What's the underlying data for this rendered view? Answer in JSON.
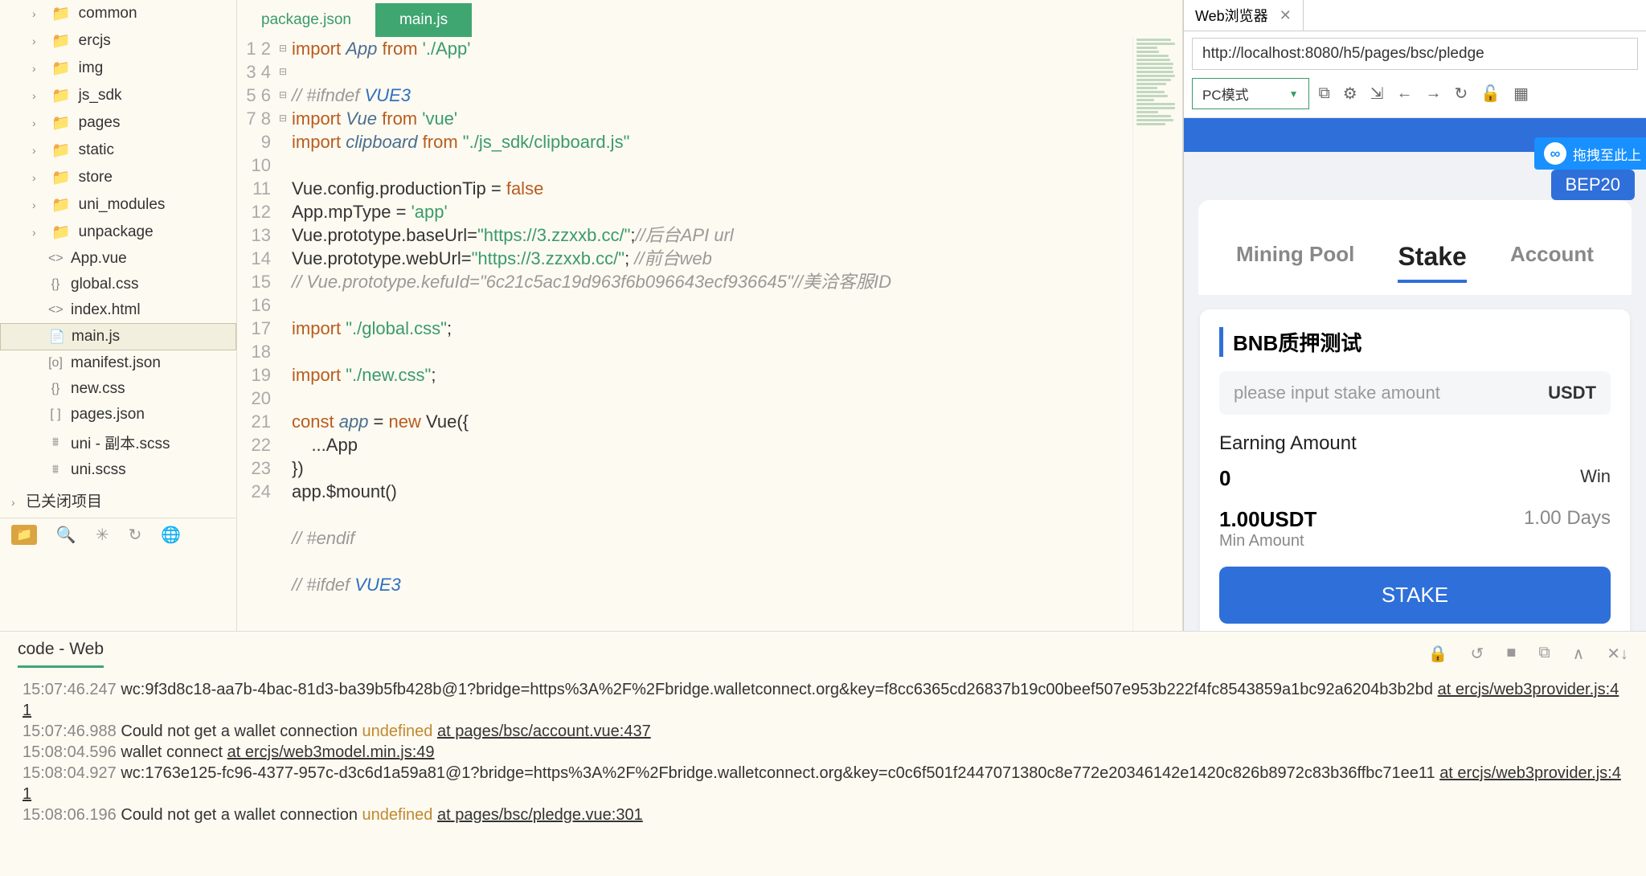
{
  "file_tree": {
    "folders": [
      {
        "name": "common"
      },
      {
        "name": "ercjs"
      },
      {
        "name": "img"
      },
      {
        "name": "js_sdk"
      },
      {
        "name": "pages"
      },
      {
        "name": "static"
      },
      {
        "name": "store"
      },
      {
        "name": "uni_modules"
      },
      {
        "name": "unpackage"
      }
    ],
    "files": [
      {
        "name": "App.vue",
        "icon": "<>",
        "sel": false
      },
      {
        "name": "global.css",
        "icon": "{}",
        "sel": false
      },
      {
        "name": "index.html",
        "icon": "<>",
        "sel": false
      },
      {
        "name": "main.js",
        "icon": "📄",
        "sel": true
      },
      {
        "name": "manifest.json",
        "icon": "[o]",
        "sel": false
      },
      {
        "name": "new.css",
        "icon": "{}",
        "sel": false
      },
      {
        "name": "pages.json",
        "icon": "[ ]",
        "sel": false
      },
      {
        "name": "uni - 副本.scss",
        "icon": "⩩",
        "sel": false
      },
      {
        "name": "uni.scss",
        "icon": "⩩",
        "sel": false
      }
    ],
    "closed_projects": "已关闭项目"
  },
  "editor": {
    "tabs": [
      {
        "label": "package.json",
        "active": false
      },
      {
        "label": "main.js",
        "active": true
      }
    ],
    "code": {
      "l1": {
        "kw": "import",
        "v": "App",
        "kw2": "from",
        "s": "'./App'"
      },
      "l3": "// #ifndef ",
      "l3v": "VUE3",
      "l4": {
        "kw": "import",
        "v": "Vue",
        "kw2": "from",
        "s": "'vue'"
      },
      "l5": {
        "kw": "import",
        "v": "clipboard",
        "kw2": "from",
        "s": "\"./js_sdk/clipboard.js\""
      },
      "l7a": "Vue.config.productionTip = ",
      "l7b": "false",
      "l8a": "App.mpType = ",
      "l8b": "'app'",
      "l9a": "Vue.prototype.baseUrl=",
      "l9b": "\"https://3.zzxxb.cc/\"",
      "l9c": ";",
      "l9d": "//后台API url",
      "l10a": "Vue.prototype.webUrl=",
      "l10b": "\"https://3.zzxxb.cc/\"",
      "l10c": "; ",
      "l10d": "//前台web",
      "l11": "// Vue.prototype.kefuId=\"6c21c5ac19d963f6b096643ecf936645\"//美洽客服ID",
      "l13a": "import ",
      "l13b": "\"./global.css\"",
      "l13c": ";",
      "l15a": "import ",
      "l15b": "\"./new.css\"",
      "l15c": ";",
      "l17a": "const",
      "l17b": "app",
      "l17c": " = ",
      "l17d": "new",
      "l17e": " Vue({",
      "l18": "    ...App",
      "l19": "})",
      "l20": "app.$mount()",
      "l22": "// #endif",
      "l24": "// #ifdef ",
      "l24v": "VUE3"
    }
  },
  "browser": {
    "tab_title": "Web浏览器",
    "url": "http://localhost:8080/h5/pages/bsc/pledge",
    "mode": "PC模式",
    "drag_hint": "拖拽至此上",
    "bep": "BEP20",
    "nav": [
      {
        "label": "Mining Pool",
        "active": false
      },
      {
        "label": "Stake",
        "active": true
      },
      {
        "label": "Account",
        "active": false
      }
    ],
    "card": {
      "title": "BNB质押测试",
      "placeholder": "please input stake amount",
      "currency": "USDT",
      "earning_label": "Earning Amount",
      "earning_value": "0",
      "earning_unit": "Win",
      "min_value": "1.00USDT",
      "min_label": "Min Amount",
      "days": "1.00 Days",
      "button": "STAKE"
    }
  },
  "console": {
    "tab": "code - Web",
    "lines": [
      {
        "t": "15:07:46.247",
        "txt": "wc:9f3d8c18-aa7b-4bac-81d3-ba39b5fb428b@1?bridge=https%3A%2F%2Fbridge.walletconnect.org&key=f8cc6365cd26837b19c00beef507e953b222f4fc8543859a1bc92a6204b3b2bd ",
        "link": "at ercjs/web3provider.js:41"
      },
      {
        "t": "15:07:46.988",
        "txt": "Could not get a wallet connection ",
        "undef": "undefined ",
        "link": "at pages/bsc/account.vue:437"
      },
      {
        "t": "15:08:04.596",
        "txt": "wallet connect ",
        "link": "at ercjs/web3model.min.js:49"
      },
      {
        "t": "15:08:04.927",
        "txt": "wc:1763e125-fc96-4377-957c-d3c6d1a59a81@1?bridge=https%3A%2F%2Fbridge.walletconnect.org&key=c0c6f501f2447071380c8e772e20346142e1420c826b8972c83b36ffbc71ee11 ",
        "link": "at ercjs/web3provider.js:41"
      },
      {
        "t": "15:08:06.196",
        "txt": "Could not get a wallet connection ",
        "undef": "undefined ",
        "link": "at pages/bsc/pledge.vue:301"
      }
    ]
  }
}
